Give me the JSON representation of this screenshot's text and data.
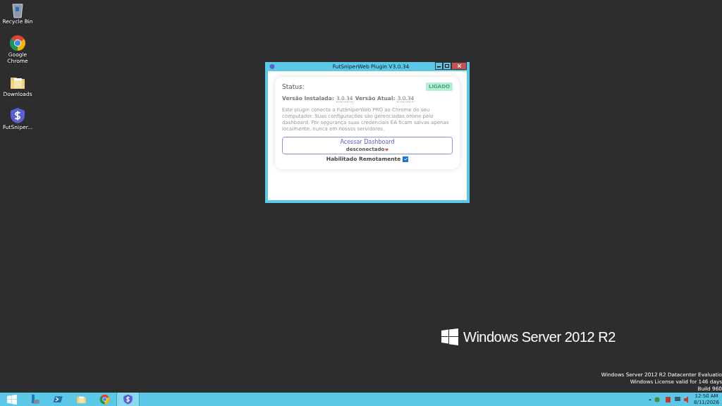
{
  "desktop_icons": [
    {
      "label": "Recycle Bin",
      "kind": "recycle"
    },
    {
      "label": "Google Chrome",
      "kind": "chrome"
    },
    {
      "label": "Downloads",
      "kind": "folder"
    },
    {
      "label": "FutSniper...",
      "kind": "shield"
    }
  ],
  "dialog": {
    "title": "FutSniperWeb Plugin V3.0.34",
    "status_label": "Status:",
    "badge": "LIGADO",
    "installed_label": "Versão Instalada:",
    "installed_version": "3.0.34",
    "current_label": "Versão Atual:",
    "current_version": "3.0.34",
    "description": "Este plugin conecta o FutSniperWeb PRO ao Chrome do seu computador. Suas configurações são gerenciadas online pelo dashboard. Por segurança suas credenciais EA ficam salvas apenas localmente, nunca em nossos servidores.",
    "dashboard_button": "Acessar Dashboard",
    "connection_status": "desconectado",
    "remote": {
      "label": "Habilitado Remotamente",
      "checked": true
    }
  },
  "watermark": {
    "logo_text": "Windows Server 2012 R2",
    "lines": [
      "Windows Server 2012 R2 Datacenter Evaluatio",
      "Windows License valid for 146 days",
      "Build 960"
    ]
  },
  "taskbar": {
    "items": [
      {
        "kind": "server-manager",
        "active": false
      },
      {
        "kind": "powershell",
        "active": false
      },
      {
        "kind": "folder",
        "active": false
      },
      {
        "kind": "chrome",
        "active": false
      },
      {
        "kind": "shield",
        "active": true
      }
    ],
    "time": "12:50 AM",
    "date": "8/11/2026"
  }
}
